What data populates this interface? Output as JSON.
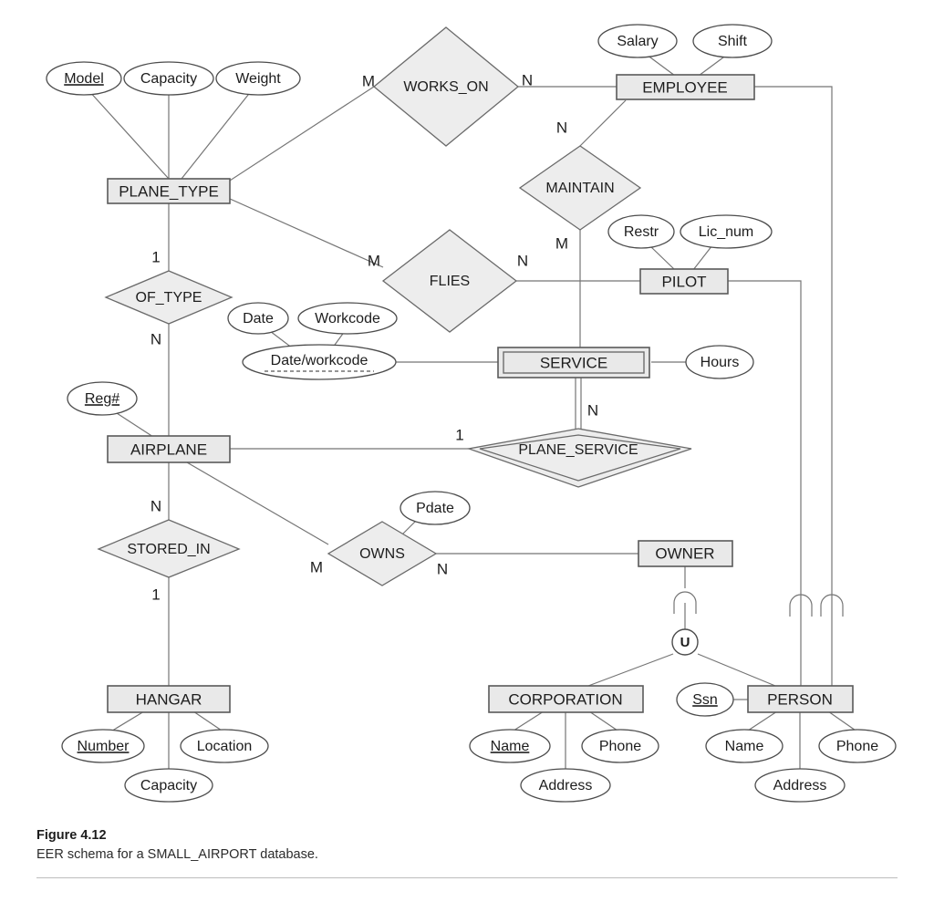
{
  "figure": {
    "number": "Figure 4.12",
    "caption": "EER schema for a SMALL_AIRPORT database."
  },
  "colors": {
    "entity_fill": "#e9e9e9",
    "relationship_fill": "#ededed",
    "attribute_fill": "#ffffff",
    "line": "#757575",
    "border": "#5a5a5a",
    "text": "#1d1d1d"
  },
  "entities": [
    {
      "id": "plane_type",
      "label": "PLANE_TYPE",
      "weak": false
    },
    {
      "id": "employee",
      "label": "EMPLOYEE",
      "weak": false
    },
    {
      "id": "pilot",
      "label": "PILOT",
      "weak": false
    },
    {
      "id": "service",
      "label": "SERVICE",
      "weak": true
    },
    {
      "id": "airplane",
      "label": "AIRPLANE",
      "weak": false
    },
    {
      "id": "hangar",
      "label": "HANGAR",
      "weak": false
    },
    {
      "id": "owner",
      "label": "OWNER",
      "weak": false
    },
    {
      "id": "corporation",
      "label": "CORPORATION",
      "weak": false
    },
    {
      "id": "person",
      "label": "PERSON",
      "weak": false
    }
  ],
  "relationships": [
    {
      "id": "works_on",
      "label": "WORKS_ON",
      "identifying": false,
      "left_card": "M",
      "right_card": "N"
    },
    {
      "id": "maintain",
      "label": "MAINTAIN",
      "identifying": false,
      "top_card": "N",
      "bottom_card": "M"
    },
    {
      "id": "flies",
      "label": "FLIES",
      "identifying": false,
      "left_card": "M",
      "right_card": "N"
    },
    {
      "id": "of_type",
      "label": "OF_TYPE",
      "identifying": false,
      "top_card": "1",
      "bottom_card": "N"
    },
    {
      "id": "plane_service",
      "label": "PLANE_SERVICE",
      "identifying": true,
      "top_card": "N",
      "left_card": "1"
    },
    {
      "id": "stored_in",
      "label": "STORED_IN",
      "identifying": false,
      "top_card": "N",
      "bottom_card": "1"
    },
    {
      "id": "owns",
      "label": "OWNS",
      "identifying": false,
      "left_card": "M",
      "right_card": "N"
    }
  ],
  "attributes": {
    "plane_type": [
      {
        "label": "Model",
        "key": true
      },
      {
        "label": "Capacity",
        "key": false
      },
      {
        "label": "Weight",
        "key": false
      }
    ],
    "employee": [
      {
        "label": "Salary",
        "key": false
      },
      {
        "label": "Shift",
        "key": false
      }
    ],
    "pilot": [
      {
        "label": "Restr",
        "key": false
      },
      {
        "label": "Lic_num",
        "key": false
      }
    ],
    "service": [
      {
        "label": "Date/workcode",
        "partial_key": true
      },
      {
        "label": "Date",
        "key": false
      },
      {
        "label": "Workcode",
        "key": false
      },
      {
        "label": "Hours",
        "key": false
      }
    ],
    "airplane": [
      {
        "label": "Reg#",
        "key": true
      }
    ],
    "hangar": [
      {
        "label": "Number",
        "key": true
      },
      {
        "label": "Location",
        "key": false
      },
      {
        "label": "Capacity",
        "key": false
      }
    ],
    "owns": [
      {
        "label": "Pdate",
        "key": false
      }
    ],
    "corporation": [
      {
        "label": "Name",
        "key": true
      },
      {
        "label": "Phone",
        "key": false
      },
      {
        "label": "Address",
        "key": false
      }
    ],
    "person": [
      {
        "label": "Ssn",
        "key": true
      },
      {
        "label": "Name",
        "key": false
      },
      {
        "label": "Phone",
        "key": false
      },
      {
        "label": "Address",
        "key": false
      }
    ]
  },
  "category": {
    "symbol": "U",
    "superclasses": [
      "CORPORATION",
      "PERSON"
    ],
    "subclass": "OWNER"
  },
  "cardinality_labels": {
    "plane_type_works_on": "M",
    "works_on_employee": "N",
    "employee_maintain": "N",
    "maintain_service": "M",
    "plane_type_flies": "M",
    "flies_pilot": "N",
    "plane_type_of_type": "1",
    "of_type_airplane": "N",
    "service_plane_service": "N",
    "airplane_plane_service": "1",
    "airplane_stored_in": "N",
    "stored_in_hangar": "1",
    "airplane_owns": "M",
    "owns_owner": "N"
  }
}
